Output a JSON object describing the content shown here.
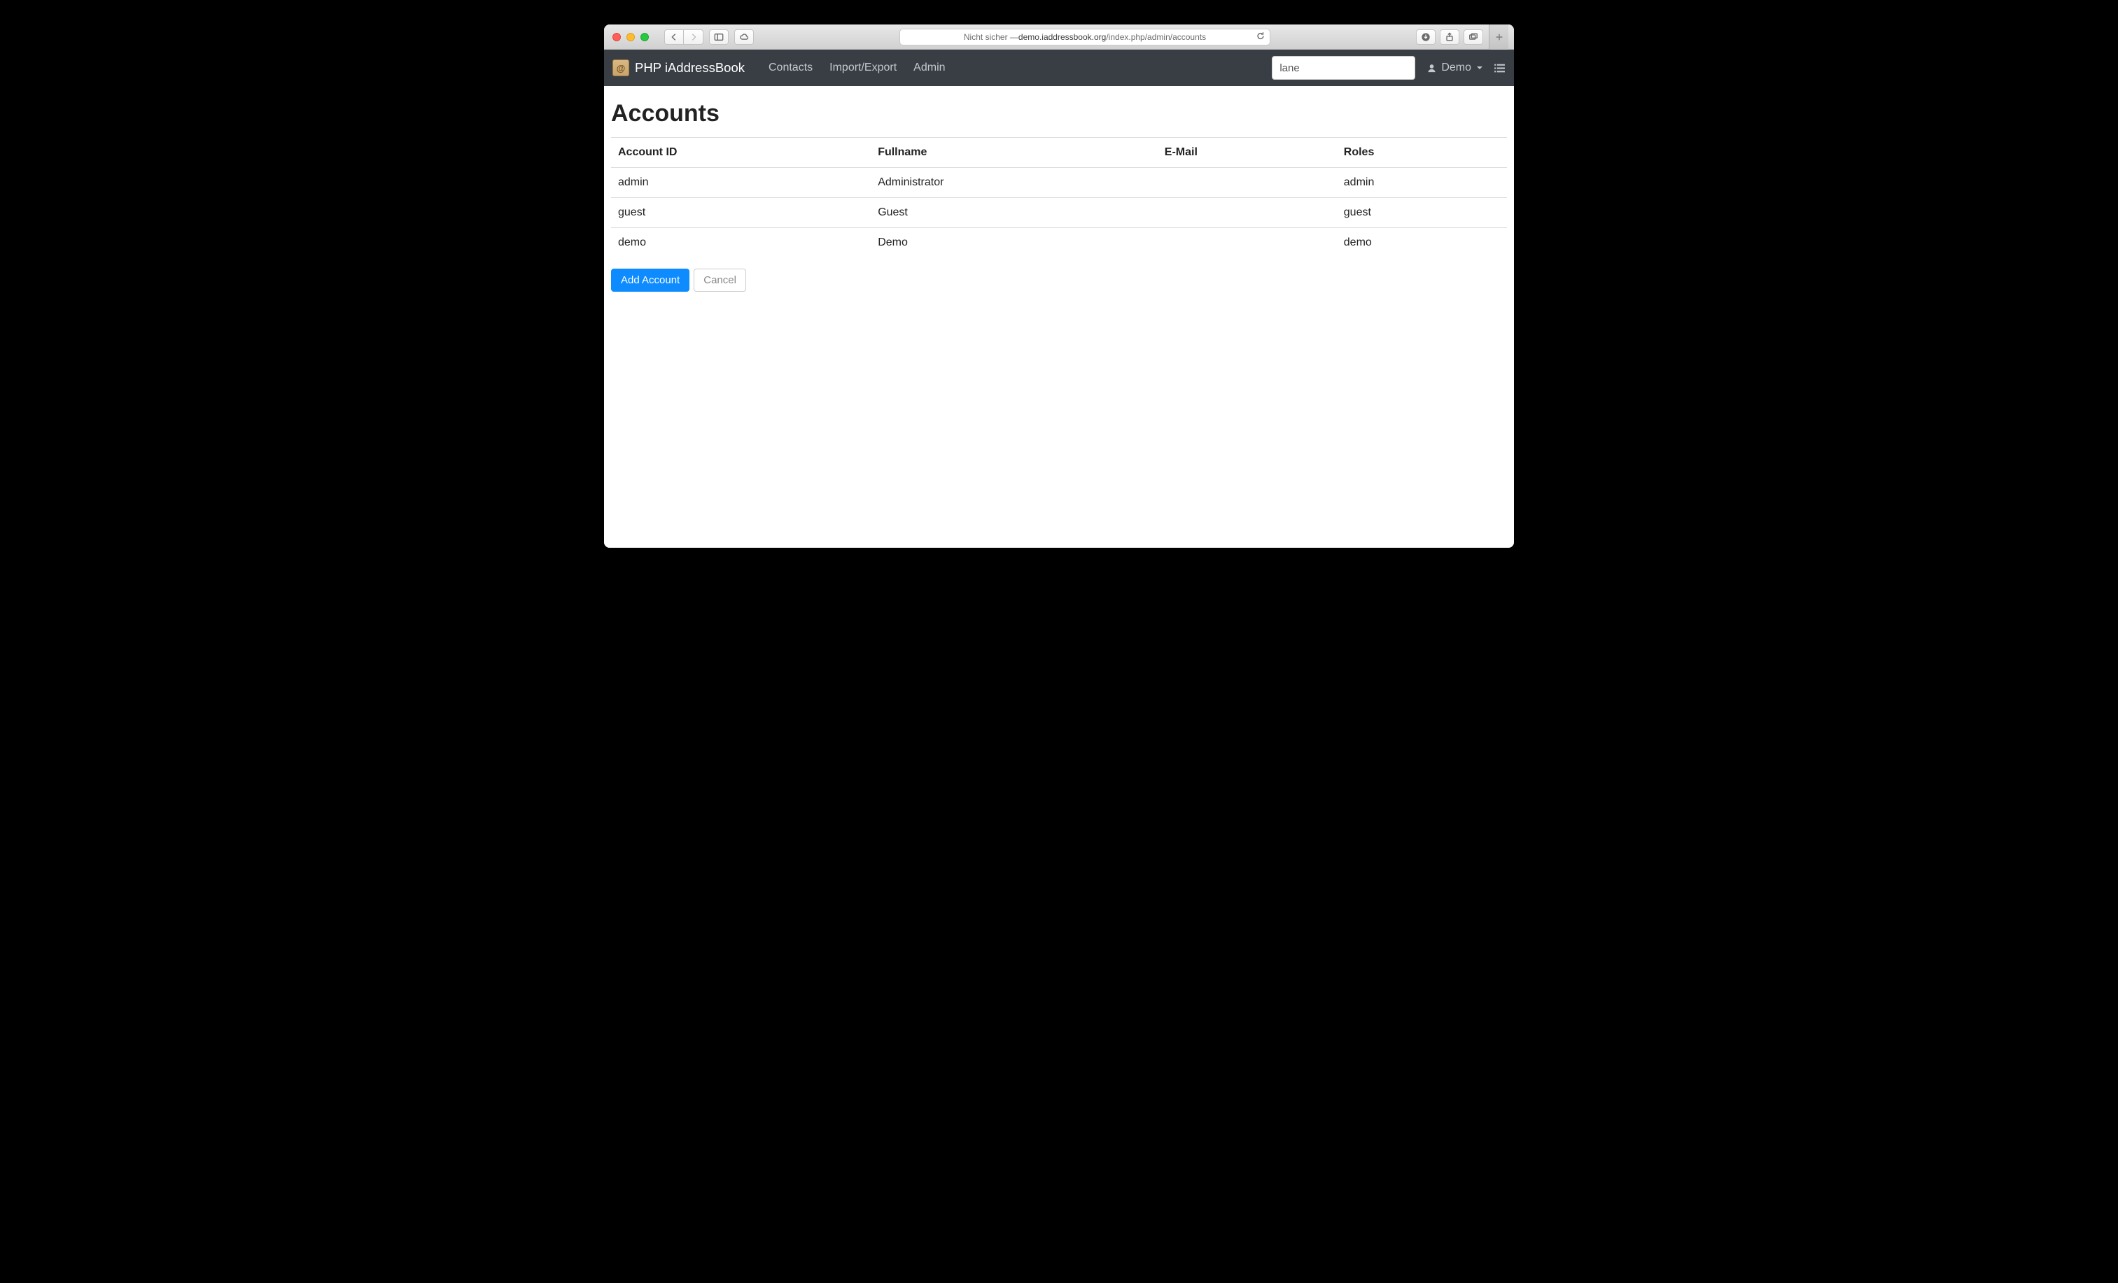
{
  "browser": {
    "address_prefix": "Nicht sicher — ",
    "address_host": "demo.iaddressbook.org",
    "address_path": "/index.php/admin/accounts"
  },
  "navbar": {
    "brand": "PHP iAddressBook",
    "links": [
      "Contacts",
      "Import/Export",
      "Admin"
    ],
    "search_value": "lane",
    "user_label": "Demo"
  },
  "page": {
    "title": "Accounts",
    "headers": {
      "id": "Account ID",
      "fullname": "Fullname",
      "email": "E-Mail",
      "roles": "Roles"
    },
    "rows": [
      {
        "id": "admin",
        "fullname": "Administrator",
        "email": "",
        "roles": "admin"
      },
      {
        "id": "guest",
        "fullname": "Guest",
        "email": "",
        "roles": "guest"
      },
      {
        "id": "demo",
        "fullname": "Demo",
        "email": "",
        "roles": "demo"
      }
    ],
    "buttons": {
      "add": "Add Account",
      "cancel": "Cancel"
    }
  }
}
